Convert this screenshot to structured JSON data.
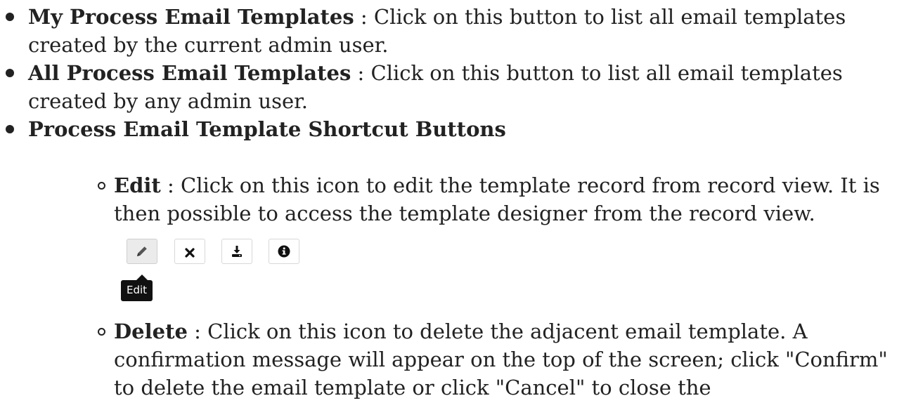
{
  "items": [
    {
      "title": "My Process Email Templates",
      "sep": " : ",
      "desc": "Click on this button to list all email templates created by the current admin user."
    },
    {
      "title": "All Process Email Templates",
      "sep": " : ",
      "desc": "Click on this button to list all email templates created by any admin user."
    },
    {
      "title": "Process Email Template Shortcut Buttons",
      "subitems": [
        {
          "title": "Edit",
          "sep": " : ",
          "desc": "Click on this icon to edit the template record from record view. It is then possible to access the template designer from the record view."
        },
        {
          "title": "Delete",
          "sep": " : ",
          "desc": "Click on this icon to delete the adjacent email template. A confirmation message will appear on the top of the screen; click \"Confirm\" to delete the email template or click \"Cancel\" to close the"
        }
      ]
    }
  ],
  "icon_buttons": [
    {
      "icon": "pencil-icon",
      "active": true
    },
    {
      "icon": "close-icon",
      "active": false
    },
    {
      "icon": "download-icon",
      "active": false
    },
    {
      "icon": "info-icon",
      "active": false
    }
  ],
  "tooltip": "Edit"
}
